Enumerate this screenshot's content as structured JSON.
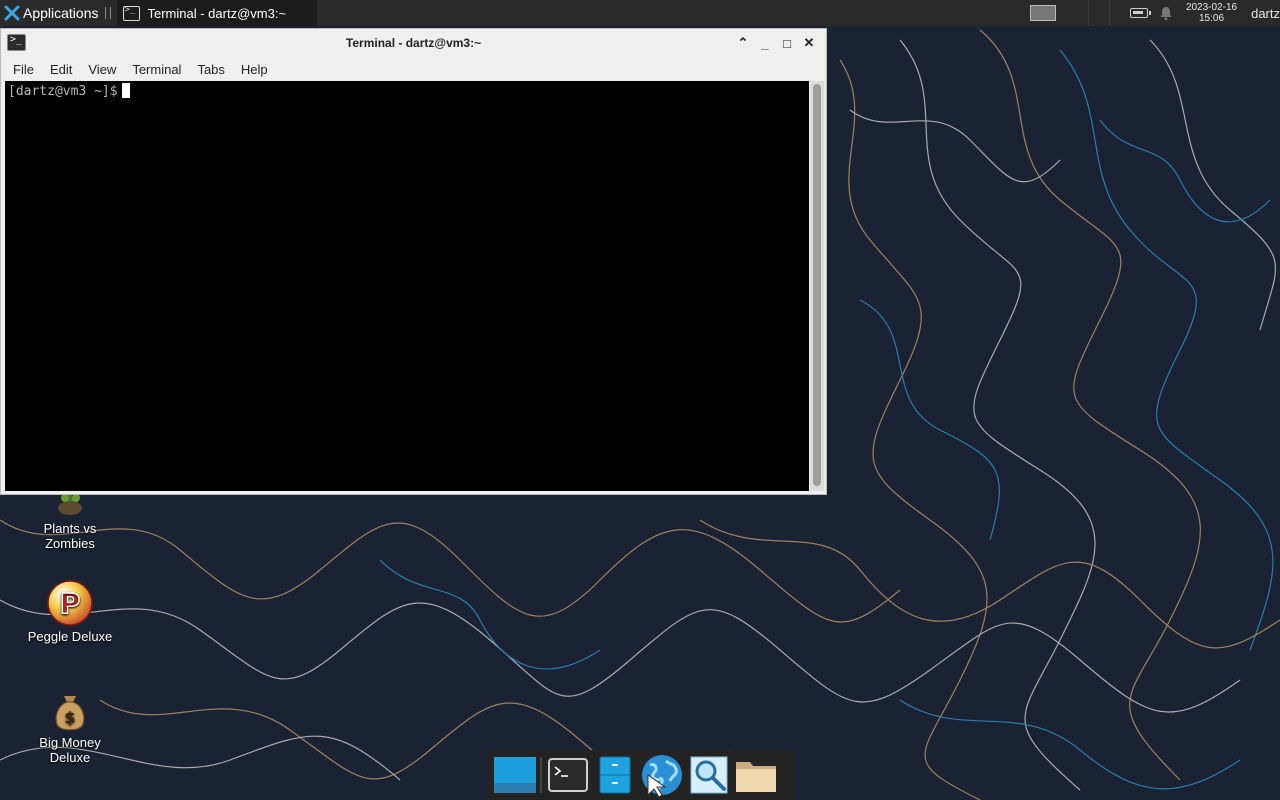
{
  "top_panel": {
    "applications_label": "Applications",
    "task_title": "Terminal - dartz@vm3:~",
    "clock_date": "2023-02-16",
    "clock_time": "15:06",
    "user": "dartz"
  },
  "window": {
    "title": "Terminal - dartz@vm3:~",
    "controls": {
      "shade": "⌃",
      "minimize": "_",
      "maximize": "□",
      "close": "✕"
    },
    "menu": [
      "File",
      "Edit",
      "View",
      "Terminal",
      "Tabs",
      "Help"
    ],
    "prompt": "[dartz@vm3 ~]$"
  },
  "desktop_icons": [
    {
      "label": "Plants vs\nZombies",
      "icon": "plants-vs-zombies-icon"
    },
    {
      "label": "Peggle Deluxe",
      "icon": "peggle-icon"
    },
    {
      "label": "Big Money\nDeluxe",
      "icon": "money-bag-icon"
    }
  ],
  "dock": [
    {
      "name": "show-desktop-icon"
    },
    {
      "name": "terminal-icon"
    },
    {
      "name": "file-cabinet-icon"
    },
    {
      "name": "web-browser-icon"
    },
    {
      "name": "app-finder-icon"
    },
    {
      "name": "folder-icon"
    }
  ],
  "colors": {
    "panel_bg": "#2a2a2a",
    "wallpaper_bg": "#1b2233",
    "accent": "#1fa3e0"
  }
}
